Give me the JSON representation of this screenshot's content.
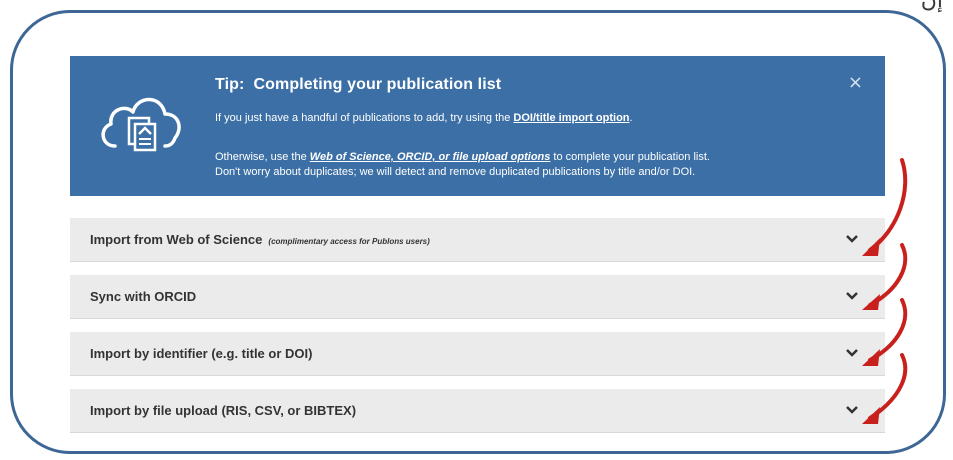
{
  "corner_glyph": "إن",
  "tip": {
    "prefix": "Tip:",
    "title": "Completing your publication list",
    "line1_text": "If you just have a handful of publications to add, try using the ",
    "line1_link": "DOI/title import option",
    "line1_end": ".",
    "line2_text": "Otherwise, use the ",
    "line2_link": "Web of Science, ORCID, or file upload options",
    "line2_end": " to complete your publication list.",
    "line3_text": "Don't worry about duplicates; we will detect and remove duplicated publications by title and/or DOI.",
    "close_glyph": "×",
    "icon": "cloud-document-icon"
  },
  "import_options": [
    {
      "label": "Import from Web of Science",
      "note": "(complimentary access for Publons users)"
    },
    {
      "label": "Sync with ORCID",
      "note": ""
    },
    {
      "label": "Import by identifier (e.g. title or DOI)",
      "note": ""
    },
    {
      "label": "Import by file upload (RIS, CSV, or BIBTEX)",
      "note": ""
    }
  ],
  "colors": {
    "tip_background": "#3b6fa5",
    "row_background": "#ebebeb",
    "frame_border": "#3e6796",
    "arrow": "#c8211d"
  }
}
